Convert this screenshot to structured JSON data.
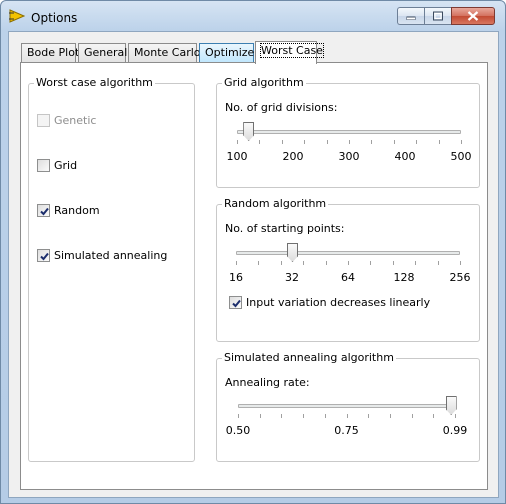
{
  "window": {
    "title": "Options"
  },
  "tabs": [
    {
      "label": "Bode Plot"
    },
    {
      "label": "General"
    },
    {
      "label": "Monte Carlo"
    },
    {
      "label": "Optimizer"
    },
    {
      "label": "Worst Case"
    }
  ],
  "active_tab": "Worst Case",
  "worst_case": {
    "title": "Worst case algorithm",
    "options": [
      {
        "label": "Genetic",
        "checked": false,
        "enabled": false
      },
      {
        "label": "Grid",
        "checked": false,
        "enabled": true
      },
      {
        "label": "Random",
        "checked": true,
        "enabled": true
      },
      {
        "label": "Simulated annealing",
        "checked": true,
        "enabled": true
      }
    ]
  },
  "grid": {
    "title": "Grid algorithm",
    "label": "No. of grid divisions:",
    "tick_labels": [
      "100",
      "200",
      "300",
      "400",
      "500"
    ],
    "slider_fraction": 0.05
  },
  "random": {
    "title": "Random algorithm",
    "label": "No. of starting points:",
    "tick_labels": [
      "16",
      "32",
      "64",
      "128",
      "256"
    ],
    "slider_fraction": 0.25,
    "linear_label": "Input variation decreases linearly",
    "linear_checked": true
  },
  "annealing": {
    "title": "Simulated annealing algorithm",
    "label": "Annealing rate:",
    "tick_labels": [
      "0.50",
      "0.75",
      "0.99"
    ],
    "slider_fraction": 0.98
  },
  "colors": {
    "titlebar": "#bcd2ea",
    "close_button": "#c24a33",
    "hover_tab": "#bee6fd"
  }
}
